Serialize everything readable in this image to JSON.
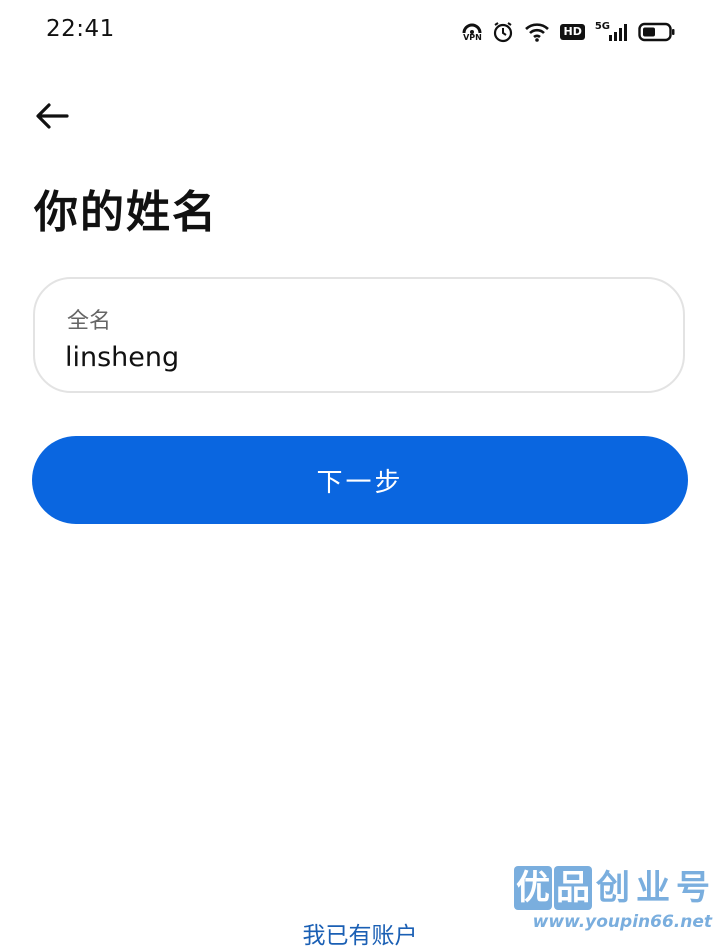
{
  "status_bar": {
    "time": "22:41",
    "vpn_label": "VPN",
    "hd_label": "HD",
    "network_label": "5G",
    "icons": [
      "vpn-icon",
      "alarm-icon",
      "wifi-icon",
      "hd-icon",
      "signal-icon",
      "battery-icon"
    ]
  },
  "header": {
    "back_icon": "arrow-left-icon",
    "title": "你的姓名"
  },
  "form": {
    "name_field": {
      "label": "全名",
      "value": "linsheng"
    },
    "next_label": "下一步"
  },
  "footer": {
    "have_account_label": "我已有账户"
  },
  "watermark": {
    "logo_chars": [
      "优",
      "品",
      "创",
      "业",
      "号"
    ],
    "url": "www.youpin66.net"
  },
  "colors": {
    "accent": "#0a66e0",
    "link": "#1a5fb4",
    "field_border": "#e3e3e3",
    "watermark": "#7aaede"
  }
}
